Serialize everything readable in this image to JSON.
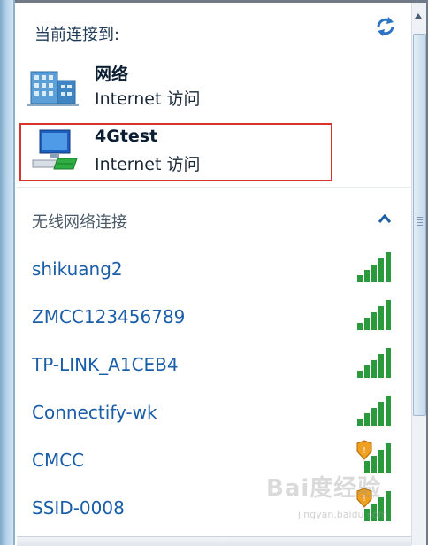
{
  "header": {
    "connected_to": "当前连接到:"
  },
  "connections": [
    {
      "name": "网络",
      "status": "Internet 访问",
      "icon": "network-building-icon"
    },
    {
      "name": "4Gtest",
      "status": "Internet 访问",
      "icon": "network-computer-icon"
    }
  ],
  "wireless": {
    "heading": "无线网络连接",
    "networks": [
      {
        "ssid": "shikuang2",
        "signal": 5,
        "secured": false
      },
      {
        "ssid": "ZMCC123456789",
        "signal": 5,
        "secured": false
      },
      {
        "ssid": "TP-LINK_A1CEB4",
        "signal": 5,
        "secured": false
      },
      {
        "ssid": "Connectify-wk",
        "signal": 5,
        "secured": false
      },
      {
        "ssid": "CMCC",
        "signal": 5,
        "secured": true
      },
      {
        "ssid": "SSID-0008",
        "signal": 5,
        "secured": true
      }
    ]
  },
  "watermark": {
    "logo": "Bai度经验",
    "url": "jingyan.baidu.com"
  },
  "colors": {
    "highlight": "#d9342b",
    "link": "#1a5ea8",
    "signal": "#2a9a3c"
  }
}
